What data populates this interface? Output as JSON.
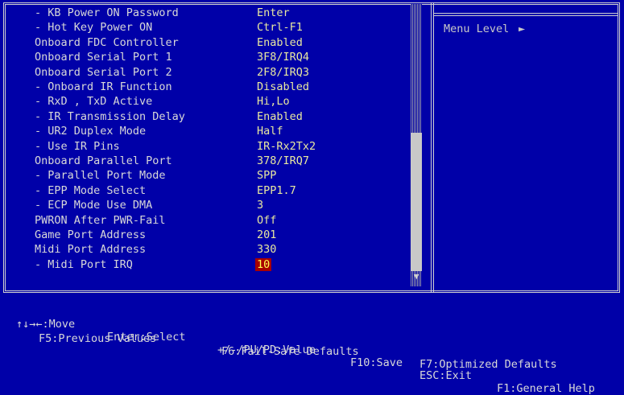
{
  "settings": [
    {
      "label": "- KB Power ON Password",
      "value": "Enter"
    },
    {
      "label": "- Hot Key Power ON",
      "value": "Ctrl-F1"
    },
    {
      "label": "Onboard FDC Controller",
      "value": "Enabled"
    },
    {
      "label": "Onboard Serial Port 1",
      "value": "3F8/IRQ4"
    },
    {
      "label": "Onboard Serial Port 2",
      "value": "2F8/IRQ3"
    },
    {
      "label": "- Onboard IR Function",
      "value": "Disabled"
    },
    {
      "label": "- RxD , TxD Active",
      "value": "Hi,Lo"
    },
    {
      "label": "- IR Transmission Delay",
      "value": "Enabled"
    },
    {
      "label": "- UR2 Duplex Mode",
      "value": "Half"
    },
    {
      "label": "- Use IR Pins",
      "value": "IR-Rx2Tx2"
    },
    {
      "label": "Onboard Parallel Port",
      "value": "378/IRQ7"
    },
    {
      "label": "- Parallel Port Mode",
      "value": "SPP"
    },
    {
      "label": "- EPP Mode Select",
      "value": "EPP1.7"
    },
    {
      "label": "- ECP Mode Use DMA",
      "value": "3"
    },
    {
      "label": "PWRON After PWR-Fail",
      "value": "Off"
    },
    {
      "label": "Game Port Address",
      "value": "201"
    },
    {
      "label": "Midi Port Address",
      "value": "330"
    },
    {
      "label": "- Midi Port IRQ",
      "value": "10"
    }
  ],
  "selected_index": 17,
  "help": {
    "menu_level_label": "Menu Level",
    "menu_level_arrow": "►"
  },
  "scroll": {
    "arrow": "▼"
  },
  "footer": {
    "move": "↑↓→←:Move",
    "select": "Enter:Select",
    "value": "+/-/PU/PD:Value",
    "save": "F10:Save",
    "exit": "ESC:Exit",
    "help": "F1:General Help",
    "previous": "F5:Previous Values",
    "failsafe": "F6:Fail-Safe Defaults",
    "optimized": "F7:Optimized Defaults"
  },
  "colors": {
    "background": "#0000a8",
    "selected_bg": "#a80000",
    "selected_fg": "#ffff55",
    "value_fg": "#e8e8a0"
  }
}
